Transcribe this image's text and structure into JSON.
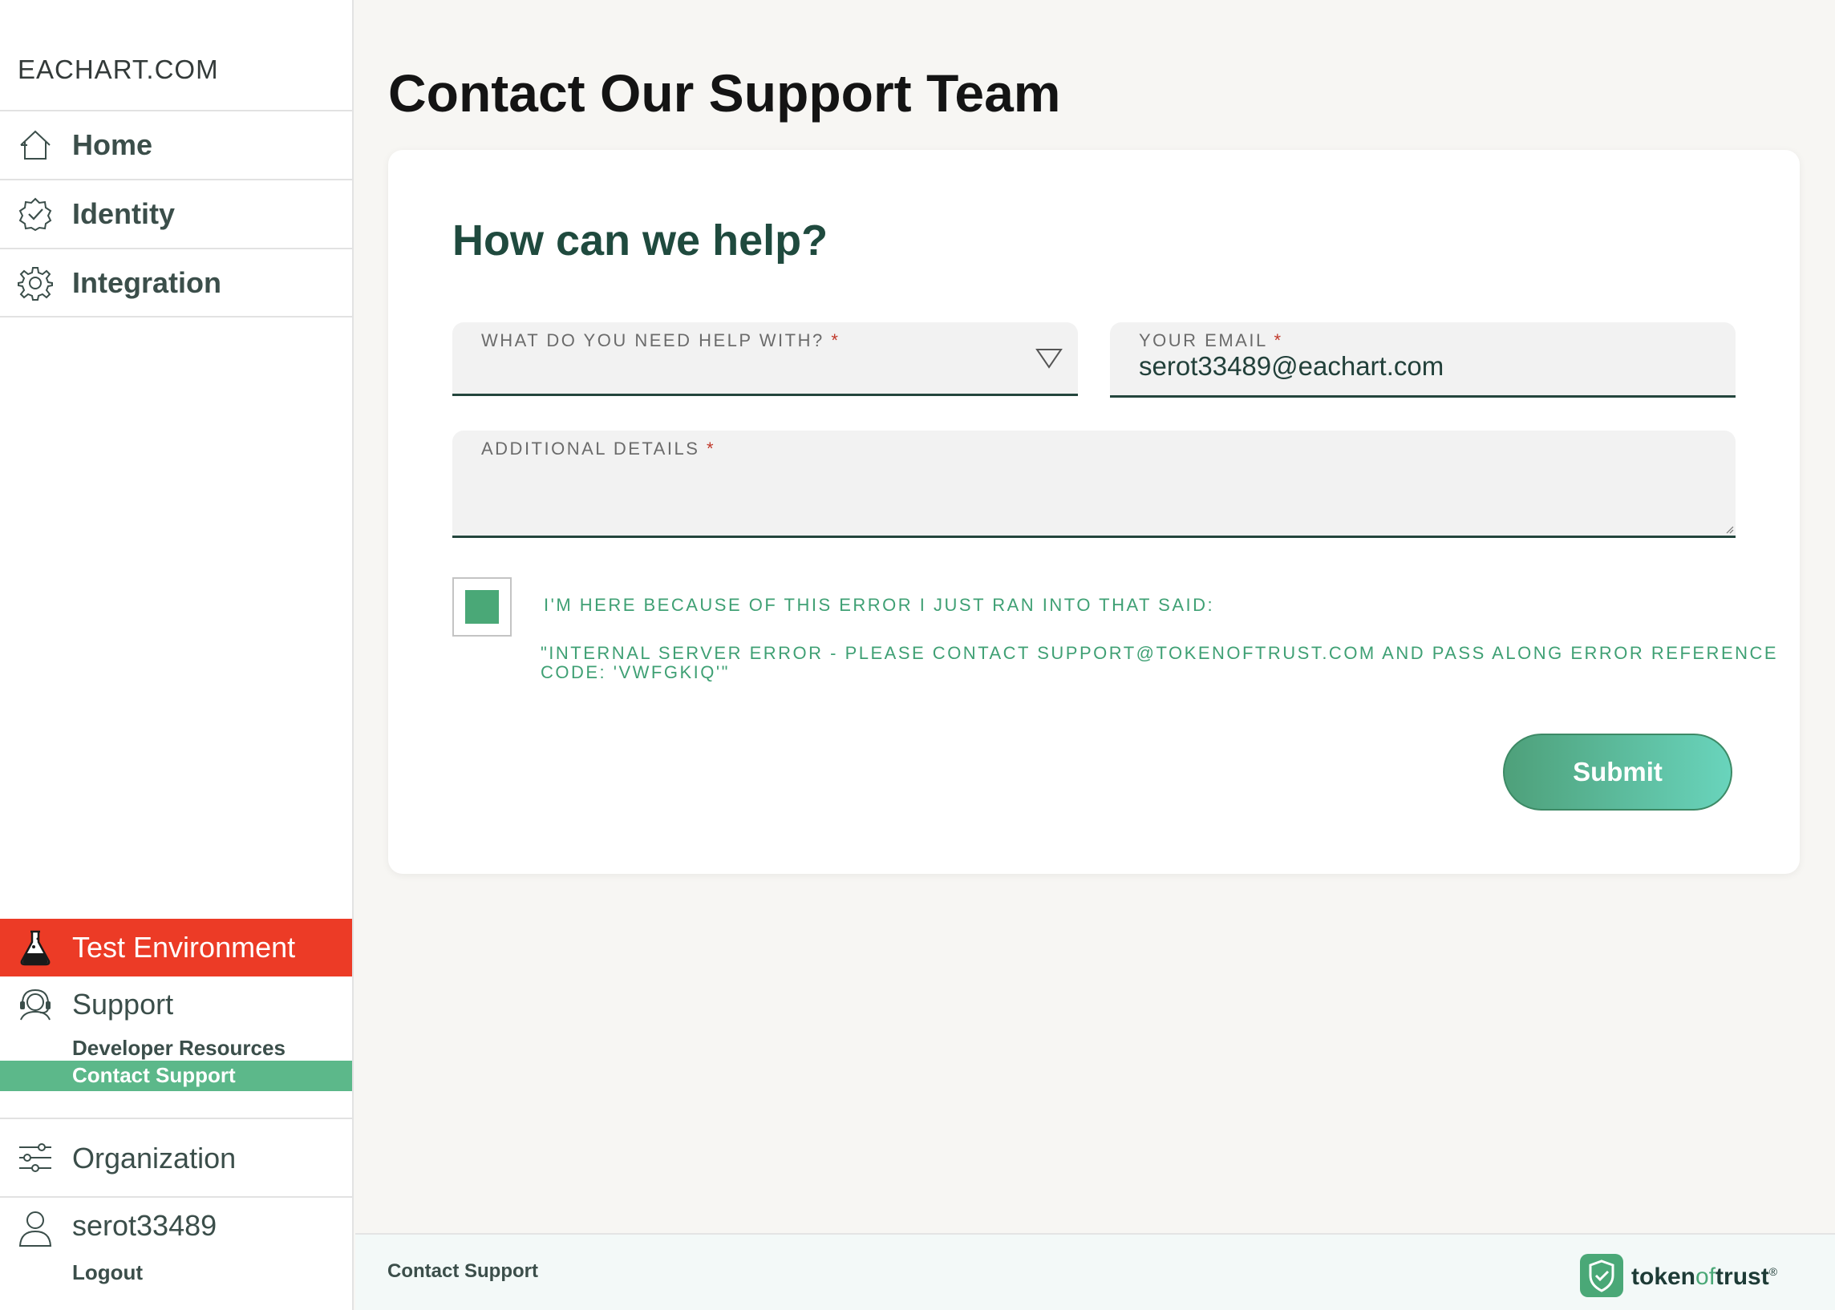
{
  "sidebar": {
    "brand": "EACHART.COM",
    "nav": [
      {
        "label": "Home",
        "icon": "home-icon"
      },
      {
        "label": "Identity",
        "icon": "verified-badge-icon"
      },
      {
        "label": "Integration",
        "icon": "gear-icon"
      }
    ],
    "test_env": {
      "label": "Test Environment",
      "icon": "flask-icon",
      "color": "#ec3b26"
    },
    "support": {
      "label": "Support",
      "icon": "headset-icon",
      "links": [
        "Developer Resources",
        "Contact Support"
      ],
      "active": "Contact Support",
      "active_color": "#5cb88a"
    },
    "organization": {
      "label": "Organization",
      "icon": "sliders-icon"
    },
    "user": {
      "name": "serot33489",
      "logout": "Logout",
      "icon": "user-icon"
    }
  },
  "main": {
    "title": "Contact Our Support Team",
    "card": {
      "heading": "How can we help?",
      "help_field": {
        "label": "WHAT DO YOU NEED HELP WITH?",
        "value": "",
        "required": "*"
      },
      "email_field": {
        "label": "YOUR EMAIL",
        "value": "serot33489@eachart.com",
        "required": "*"
      },
      "details_field": {
        "label": "ADDITIONAL DETAILS",
        "value": "",
        "required": "*"
      },
      "error_checkbox": {
        "checked": true,
        "label": "I'M HERE BECAUSE OF THIS ERROR I JUST RAN INTO THAT SAID:",
        "message_line1": "\"INTERNAL SERVER ERROR - PLEASE CONTACT SUPPORT@TOKENOFTRUST.COM AND PASS ALONG ERROR REFERENCE",
        "message_line2": "CODE: 'VWFGKIQ'\""
      },
      "submit_label": "Submit"
    }
  },
  "footer": {
    "link": "Contact Support",
    "logo": {
      "part1": "token",
      "part2": "of",
      "part3": "trust",
      "mark": "®"
    }
  },
  "colors": {
    "accent": "#4aa877",
    "dark_green": "#24463d",
    "test_env": "#ec3b26"
  }
}
